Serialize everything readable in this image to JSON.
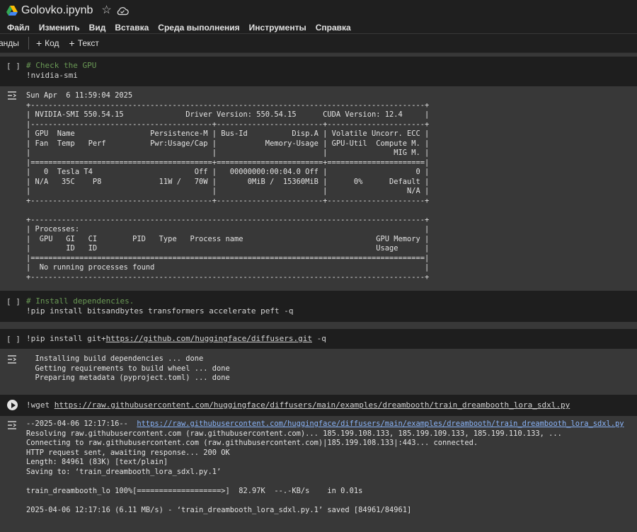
{
  "titlebar": {
    "title": "Golovko.ipynb",
    "icons": [
      "drive-icon",
      "star-icon",
      "cloud-icon"
    ]
  },
  "menu": [
    "Файл",
    "Изменить",
    "Вид",
    "Вставка",
    "Среда выполнения",
    "Инструменты",
    "Справка"
  ],
  "toolbar": {
    "commands_label": "анды",
    "add_code": "Код",
    "add_text": "Текст"
  },
  "cells": {
    "gpu": {
      "bracket": "[ ]",
      "comment": "# Check the GPU",
      "command": "!nvidia-smi",
      "output": "Sun Apr  6 11:59:04 2025       \n+-----------------------------------------------------------------------------------------+\n| NVIDIA-SMI 550.54.15              Driver Version: 550.54.15      CUDA Version: 12.4     |\n|-----------------------------------------+------------------------+----------------------+\n| GPU  Name                 Persistence-M | Bus-Id          Disp.A | Volatile Uncorr. ECC |\n| Fan  Temp   Perf          Pwr:Usage/Cap |           Memory-Usage | GPU-Util  Compute M. |\n|                                         |                        |               MIG M. |\n|=========================================+========================+======================|\n|   0  Tesla T4                       Off |   00000000:00:04.0 Off |                    0 |\n| N/A   35C    P8             11W /   70W |       0MiB /  15360MiB |      0%      Default |\n|                                         |                        |                  N/A |\n+-----------------------------------------+------------------------+----------------------+\n                                                                                         \n+-----------------------------------------------------------------------------------------+\n| Processes:                                                                              |\n|  GPU   GI   CI        PID   Type   Process name                              GPU Memory |\n|        ID   ID                                                               Usage      |\n|=========================================================================================|\n|  No running processes found                                                             |\n+-----------------------------------------------------------------------------------------+"
    },
    "install": {
      "bracket": "[ ]",
      "comment": "# Install dependencies.",
      "command": "!pip install bitsandbytes transformers accelerate peft -q"
    },
    "diffusers": {
      "bracket": "[ ]",
      "cmd_prefix": "!pip install git+",
      "cmd_link": "https://github.com/huggingface/diffusers.git",
      "cmd_suffix": " -q",
      "output": "  Installing build dependencies ... done\n  Getting requirements to build wheel ... done\n  Preparing metadata (pyproject.toml) ... done"
    },
    "wget": {
      "cmd_prefix": "!wget ",
      "cmd_link": "https://raw.githubusercontent.com/huggingface/diffusers/main/examples/dreambooth/train_dreambooth_lora_sdxl.py",
      "out_prefix": "--2025-04-06 12:17:16--  ",
      "out_link": "https://raw.githubusercontent.com/huggingface/diffusers/main/examples/dreambooth/train_dreambooth_lora_sdxl.py",
      "output": "Resolving raw.githubusercontent.com (raw.githubusercontent.com)... 185.199.108.133, 185.199.109.133, 185.199.110.133, ...\nConnecting to raw.githubusercontent.com (raw.githubusercontent.com)|185.199.108.133|:443... connected.\nHTTP request sent, awaiting response... 200 OK\nLength: 84961 (83K) [text/plain]\nSaving to: ‘train_dreambooth_lora_sdxl.py.1’\n\ntrain_dreambooth_lo 100%[===================>]  82.97K  --.-KB/s    in 0.01s   \n\n2025-04-06 12:17:16 (6.11 MB/s) - ‘train_dreambooth_lora_sdxl.py.1’ saved [84961/84961]"
    }
  }
}
